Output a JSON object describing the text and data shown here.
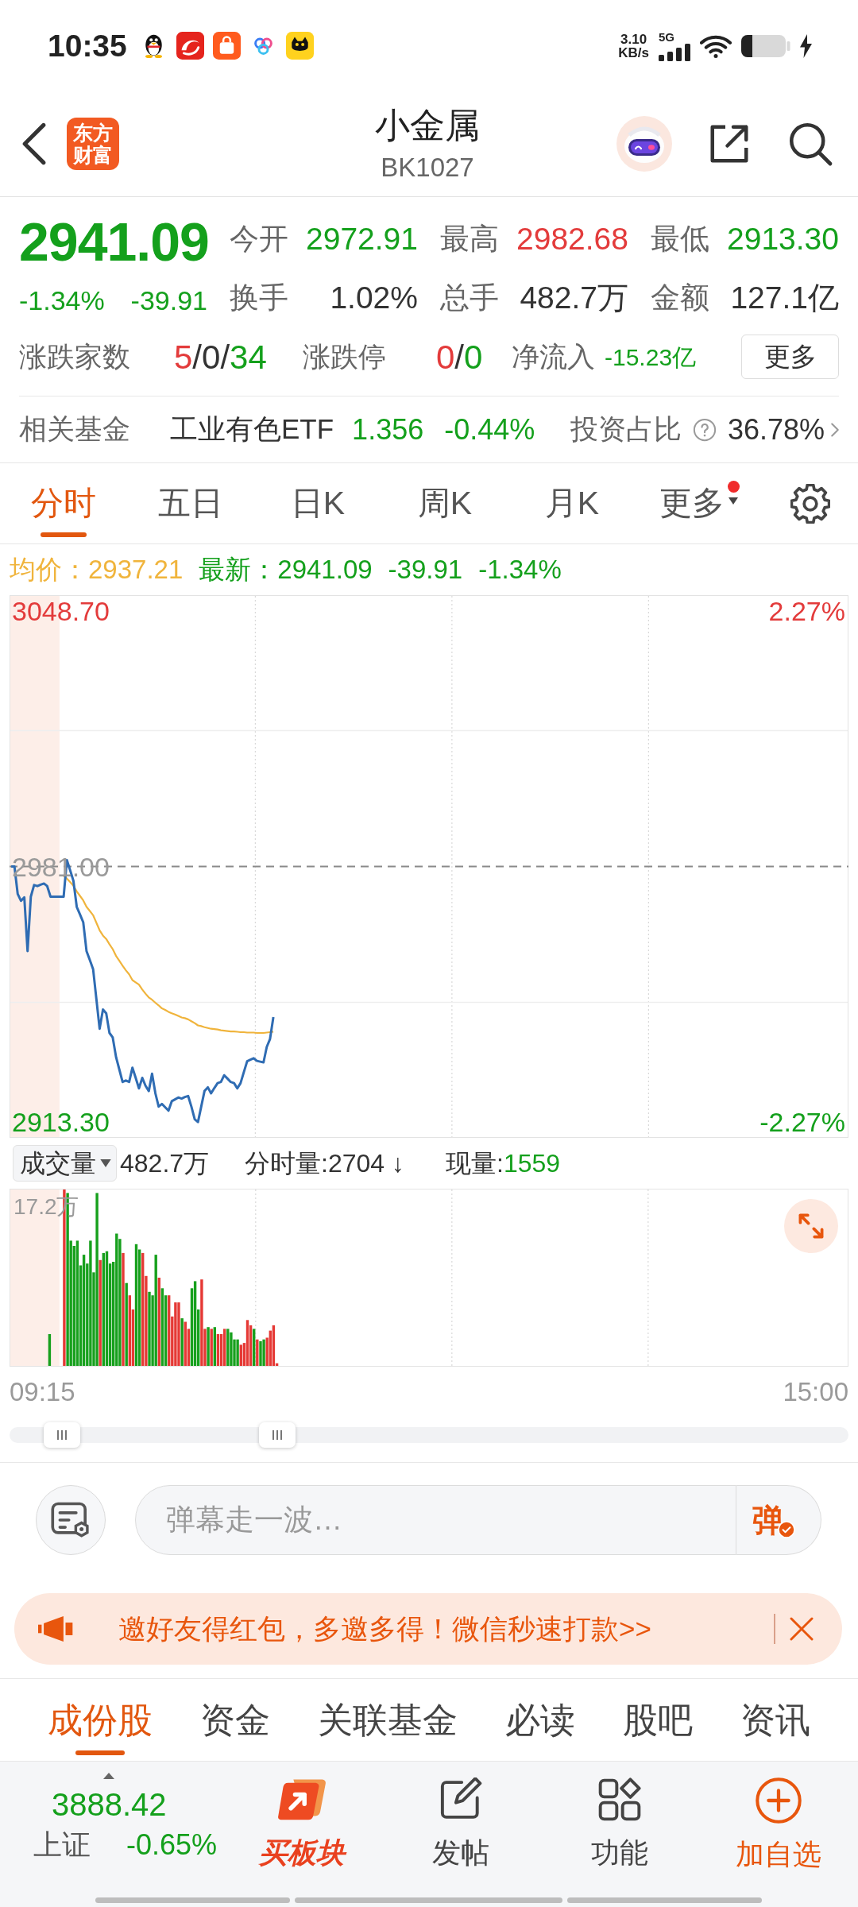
{
  "status_bar": {
    "time": "10:35",
    "net_speed": "3.10",
    "speed_unit": "KB/s",
    "network": "5G"
  },
  "header": {
    "logo": "东方财富",
    "title": "小金属",
    "code": "BK1027"
  },
  "quote": {
    "price": "2941.09",
    "falling": true,
    "change_pct": "-1.34%",
    "change": "-39.91",
    "stats": [
      {
        "label": "今开",
        "value": "2972.91",
        "color": "#14a01c"
      },
      {
        "label": "最高",
        "value": "2982.68",
        "color": "#e33b3b"
      },
      {
        "label": "最低",
        "value": "2913.30",
        "color": "#14a01c"
      },
      {
        "label": "换手",
        "value": "1.02%",
        "color": "#333333"
      },
      {
        "label": "总手",
        "value": "482.7万",
        "color": "#333333"
      },
      {
        "label": "金额",
        "value": "127.1亿",
        "color": "#333333"
      }
    ],
    "breadth": {
      "label": "涨跌家数",
      "parts": [
        {
          "text": "5",
          "color": "#e33b3b"
        },
        {
          "text": "/0/",
          "color": "#333333"
        },
        {
          "text": "34",
          "color": "#14a01c"
        }
      ]
    },
    "limit": {
      "label": "涨跌停",
      "parts": [
        {
          "text": "0",
          "color": "#e33b3b"
        },
        {
          "text": "/",
          "color": "#333333"
        },
        {
          "text": "0",
          "color": "#14a01c"
        }
      ]
    },
    "net_inflow": {
      "label": "净流入",
      "value": "-15.23亿",
      "falling": true
    },
    "more": "更多",
    "fund": {
      "label": "相关基金",
      "name": "工业有色ETF",
      "price": "1.356",
      "change": "-0.44%",
      "falling": true,
      "ratio_label": "投资占比",
      "ratio": "36.78%"
    }
  },
  "tabs": [
    {
      "label": "分时",
      "selected": true,
      "dropdown": false,
      "dot": false
    },
    {
      "label": "五日",
      "selected": false,
      "dropdown": false,
      "dot": false
    },
    {
      "label": "日K",
      "selected": false,
      "dropdown": false,
      "dot": false
    },
    {
      "label": "周K",
      "selected": false,
      "dropdown": false,
      "dot": false
    },
    {
      "label": "月K",
      "selected": false,
      "dropdown": false,
      "dot": false
    },
    {
      "label": "更多",
      "selected": false,
      "dropdown": true,
      "dot": true
    }
  ],
  "intraday": {
    "legend": [
      {
        "text": "均价：2937.21",
        "color": "#f0b43c"
      },
      {
        "text": "最新：2941.09",
        "color": "#14a01c"
      },
      {
        "text": "-39.91",
        "color": "#14a01c"
      },
      {
        "text": "-1.34%",
        "color": "#14a01c"
      }
    ],
    "chart_data": {
      "type": "line",
      "categories": [
        null,
        null,
        null,
        null,
        null,
        null,
        null,
        null,
        null,
        null,
        null,
        null,
        null,
        null,
        null,
        null,
        null,
        null,
        null,
        null,
        null,
        null,
        null,
        null,
        null,
        null,
        null,
        null,
        null,
        null,
        null,
        null,
        null,
        null,
        null,
        null,
        null,
        null,
        null,
        null,
        null,
        null,
        null,
        null,
        null,
        null,
        null,
        null,
        null,
        null,
        null,
        null,
        null,
        null,
        null,
        null,
        null,
        null,
        null,
        null,
        null,
        null,
        null,
        null,
        null,
        null,
        null,
        null,
        null,
        null,
        null,
        null,
        null,
        null,
        null,
        null,
        null,
        null,
        null,
        null,
        null,
        null,
        null,
        null,
        null,
        null,
        null,
        null,
        null,
        null,
        null,
        null,
        null,
        null,
        null,
        null,
        null,
        null,
        null,
        null,
        null,
        null,
        null,
        null,
        null,
        null,
        null,
        null,
        null,
        null,
        null,
        null,
        null,
        null,
        null,
        null,
        null,
        null,
        null,
        null,
        null,
        null,
        null,
        null,
        null,
        null,
        null,
        null,
        null,
        null,
        null,
        null,
        null,
        null,
        null,
        null,
        null,
        null,
        null,
        null,
        null,
        null,
        null,
        null,
        null,
        null,
        null,
        null,
        null,
        null,
        null,
        null,
        null,
        null,
        null,
        null,
        null,
        null,
        null,
        null,
        null,
        null,
        null,
        null,
        null,
        null,
        null,
        null,
        null,
        null,
        null,
        null,
        null,
        null,
        null,
        null,
        null,
        null,
        null,
        null,
        null,
        null,
        null,
        null,
        null,
        null,
        null,
        null,
        null,
        null,
        null,
        null,
        null,
        null,
        null,
        null,
        null,
        null,
        null,
        null,
        null,
        null,
        null,
        null,
        null,
        null,
        null,
        null,
        null,
        null,
        null,
        null,
        null,
        null,
        null,
        null,
        null,
        null,
        null,
        null,
        null,
        null,
        null,
        null,
        null,
        null,
        null,
        null,
        null,
        null,
        null,
        null,
        null,
        null,
        null,
        null,
        null,
        null,
        null,
        null,
        null,
        null,
        null,
        null,
        null,
        null,
        null,
        null,
        null,
        null,
        null,
        null,
        null,
        null,
        null,
        null
      ],
      "series": [
        {
          "color": "#f0b43c",
          "values": [
            null,
            null,
            null,
            null,
            null,
            null,
            null,
            null,
            null,
            null,
            null,
            null,
            null,
            null,
            null,
            null,
            2978.5,
            2977.8,
            2976.9,
            2975.9,
            2974.4,
            2973.2,
            2972.0,
            2970.3,
            2969.2,
            2968.1,
            2966.1,
            2964.1,
            2962.7,
            2961.8,
            2960.4,
            2959.1,
            2957.3,
            2956.0,
            2954.7,
            2953.5,
            2952.4,
            2950.9,
            2950.3,
            2949.7,
            2948.4,
            2947.3,
            2946.3,
            2945.7,
            2944.9,
            2944.2,
            2943.4,
            2943.0,
            2942.5,
            2942.1,
            2941.8,
            2941.4,
            2941.0,
            2940.8,
            2940.5,
            2940.0,
            2939.5,
            2938.9,
            2938.7,
            2938.4,
            2938.2,
            2938.0,
            2937.9,
            2937.8,
            2937.6,
            2937.5,
            2937.4,
            2937.3,
            2937.3,
            2937.2,
            2937.1,
            2937.1,
            2937.0,
            2937.0,
            2937.0,
            2936.9,
            2936.9,
            2936.9,
            2937.0,
            2937.1,
            2937.2,
            null,
            null,
            null,
            null,
            null,
            null,
            null,
            null,
            null,
            null,
            null,
            null,
            null,
            null,
            null,
            null,
            null,
            null,
            null,
            null,
            null,
            null,
            null,
            null,
            null,
            null,
            null,
            null,
            null,
            null,
            null,
            null,
            null,
            null,
            null,
            null,
            null,
            null,
            null,
            null,
            null,
            null,
            null,
            null,
            null,
            null,
            null,
            null,
            null,
            null,
            null,
            null,
            null,
            null,
            null,
            null,
            null,
            null,
            null,
            null,
            null,
            null,
            null,
            null,
            null,
            null,
            null,
            null,
            null,
            null,
            null,
            null,
            null,
            null,
            null,
            null,
            null,
            null,
            null,
            null,
            null,
            null,
            null,
            null,
            null,
            null,
            null,
            null,
            null,
            null,
            null,
            null,
            null,
            null,
            null,
            null,
            null,
            null,
            null,
            null,
            null,
            null,
            null,
            null,
            null,
            null,
            null,
            null,
            null,
            null,
            null,
            null,
            null,
            null,
            null,
            null,
            null,
            null,
            null,
            null,
            null,
            null,
            null,
            null,
            null,
            null,
            null,
            null,
            null,
            null,
            null,
            null,
            null,
            null,
            null,
            null,
            null,
            null,
            null,
            null,
            null,
            null,
            null,
            null,
            null,
            null,
            null,
            null,
            null,
            null,
            null,
            null,
            null,
            null,
            null,
            null,
            null,
            null,
            null,
            null,
            null,
            null,
            null,
            null,
            null,
            null,
            null,
            null,
            null,
            null,
            null,
            null,
            null,
            null,
            null
          ]
        },
        {
          "color": "#2f6cb3",
          "values": [
            2981.0,
            2981.0,
            2973.7,
            2971.9,
            2972.8,
            2958.6,
            2973.0,
            2976.1,
            2975.8,
            2976.2,
            2976.5,
            2975.8,
            2973.0,
            2973.0,
            2973.0,
            2973.0,
            2973.0,
            2982.7,
            2980.0,
            2977.2,
            2970.3,
            2968.3,
            2966.2,
            2958.6,
            2956.2,
            2953.8,
            2945.9,
            2938.0,
            2943.1,
            2942.1,
            2936.9,
            2935.7,
            2930.5,
            2927.2,
            2923.9,
            2924.3,
            2923.9,
            2927.7,
            2925.0,
            2922.2,
            2925.0,
            2922.9,
            2921.5,
            2926.1,
            2920.9,
            2917.4,
            2918.1,
            2917.2,
            2916.3,
            2918.8,
            2919.3,
            2919.8,
            2919.5,
            2919.9,
            2920.2,
            2917.4,
            2914.0,
            2913.3,
            2917.4,
            2921.5,
            2922.5,
            2920.9,
            2922.3,
            2923.6,
            2923.9,
            2925.7,
            2924.8,
            2923.9,
            2923.6,
            2922.2,
            2923.6,
            2926.5,
            2929.4,
            2929.8,
            2930.2,
            2929.5,
            2929.3,
            2929.1,
            2933.2,
            2935.3,
            2941.1,
            null,
            null,
            null,
            null,
            null,
            null,
            null,
            null,
            null,
            null,
            null,
            null,
            null,
            null,
            null,
            null,
            null,
            null,
            null,
            null,
            null,
            null,
            null,
            null,
            null,
            null,
            null,
            null,
            null,
            null,
            null,
            null,
            null,
            null,
            null,
            null,
            null,
            null,
            null,
            null,
            null,
            null,
            null,
            null,
            null,
            null,
            null,
            null,
            null,
            null,
            null,
            null,
            null,
            null,
            null,
            null,
            null,
            null,
            null,
            null,
            null,
            null,
            null,
            null,
            null,
            null,
            null,
            null,
            null,
            null,
            null,
            null,
            null,
            null,
            null,
            null,
            null,
            null,
            null,
            null,
            null,
            null,
            null,
            null,
            null,
            null,
            null,
            null,
            null,
            null,
            null,
            null,
            null,
            null,
            null,
            null,
            null,
            null,
            null,
            null,
            null,
            null,
            null,
            null,
            null,
            null,
            null,
            null,
            null,
            null,
            null,
            null,
            null,
            null,
            null,
            null,
            null,
            null,
            null,
            null,
            null,
            null,
            null,
            null,
            null,
            null,
            null,
            null,
            null,
            null,
            null,
            null,
            null,
            null,
            null,
            null,
            null,
            null,
            null,
            null,
            null,
            null,
            null,
            null,
            null,
            null,
            null,
            null,
            null,
            null,
            null,
            null,
            null,
            null,
            null,
            null,
            null,
            null,
            null,
            null,
            null,
            null,
            null,
            null,
            null,
            null,
            null,
            null,
            null,
            null,
            null,
            null,
            null,
            null,
            null
          ]
        }
      ],
      "ylim": [
        2909.1,
        3052.9
      ],
      "yticks": [
        {
          "value": 3048.7,
          "label": "3048.70"
        },
        {
          "value": 2981.0,
          "label": "2981.00"
        },
        {
          "value": 2913.3,
          "label": "2913.30"
        }
      ],
      "ref_lines": [
        {
          "axis": "y",
          "value": 2981.0
        },
        {
          "axis": "y",
          "value": 3017.0
        },
        {
          "axis": "y",
          "value": 2945.0
        }
      ]
    },
    "percent_ticks": [
      "2.27%",
      "-2.27%"
    ]
  },
  "volume": {
    "selector": "成交量",
    "total": "482.7万",
    "minute_volume": "分时量:2704 ↓",
    "current_label": "现量:",
    "current": "1559",
    "current_falling": true,
    "max_label": "17.2万",
    "time_labels": [
      "09:15",
      "15:00"
    ]
  },
  "danmaku": {
    "placeholder": "弹幕走一波…",
    "send": "弹"
  },
  "banner": {
    "text": "邀好友得红包，多邀多得！微信秒速打款>>"
  },
  "bottom_tabs": [
    {
      "label": "成份股",
      "selected": true
    },
    {
      "label": "资金",
      "selected": false
    },
    {
      "label": "关联基金",
      "selected": false
    },
    {
      "label": "必读",
      "selected": false
    },
    {
      "label": "股吧",
      "selected": false
    },
    {
      "label": "资讯",
      "selected": false
    }
  ],
  "bottom_bar": {
    "index": {
      "price": "3888.42",
      "name": "上证",
      "change": "-0.65%",
      "falling": true
    },
    "actions": [
      {
        "label": "买板块",
        "kind": "brand"
      },
      {
        "label": "发帖",
        "kind": "post"
      },
      {
        "label": "功能",
        "kind": "apps"
      },
      {
        "label": "加自选",
        "kind": "add"
      }
    ]
  }
}
